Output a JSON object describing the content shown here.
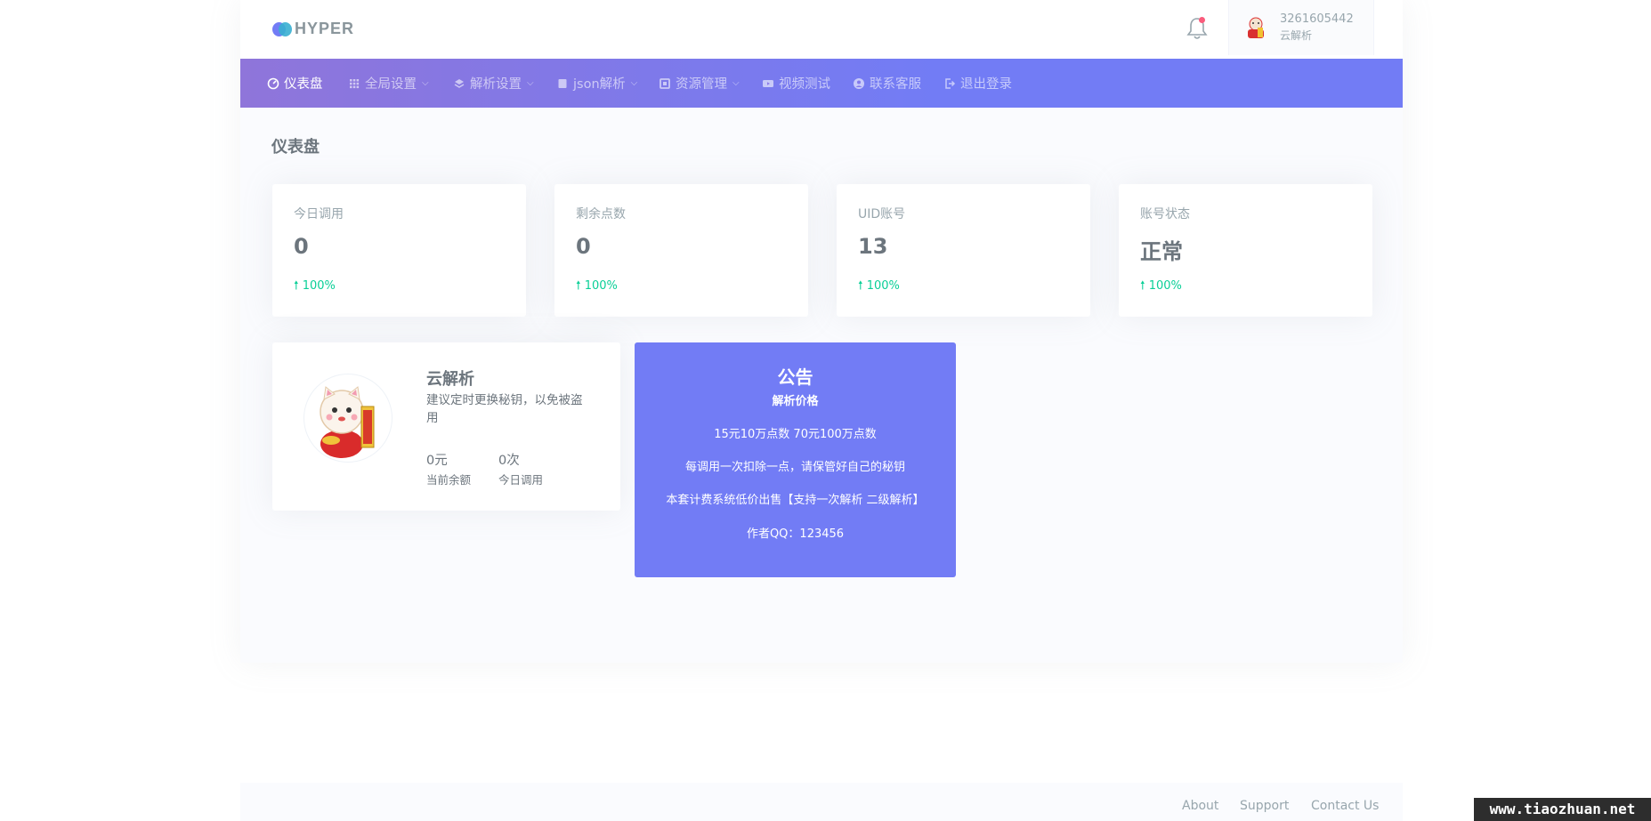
{
  "brand": {
    "logo_text": "HYPER"
  },
  "header": {
    "notification_icon": "bell-icon",
    "user": {
      "name": "3261605442",
      "role": "云解析"
    }
  },
  "nav": {
    "items": [
      {
        "label": "仪表盘",
        "icon": "dashboard-icon",
        "active": true
      },
      {
        "label": "全局设置",
        "icon": "grid-icon",
        "dropdown": true
      },
      {
        "label": "解析设置",
        "icon": "layers-icon",
        "dropdown": true
      },
      {
        "label": "json解析",
        "icon": "book-icon",
        "dropdown": true
      },
      {
        "label": "资源管理",
        "icon": "box-icon",
        "dropdown": true
      },
      {
        "label": "视频测试",
        "icon": "video-icon"
      },
      {
        "label": "联系客服",
        "icon": "user-circle-icon"
      },
      {
        "label": "退出登录",
        "icon": "logout-icon"
      }
    ]
  },
  "page": {
    "title": "仪表盘"
  },
  "stats": [
    {
      "label": "今日调用",
      "value": "0",
      "change": "100%"
    },
    {
      "label": "剩余点数",
      "value": "0",
      "change": "100%"
    },
    {
      "label": "UID账号",
      "value": "13",
      "change": "100%"
    },
    {
      "label": "账号状态",
      "value": "正常",
      "change": "100%"
    }
  ],
  "profile": {
    "name": "云解析",
    "description": "建议定时更换秘钥，以免被盗用",
    "stat1_value": "0元",
    "stat1_label": "当前余额",
    "stat2_value": "0次",
    "stat2_label": "今日调用"
  },
  "notice": {
    "title": "公告",
    "subtitle": "解析价格",
    "lines": [
      "15元10万点数 70元100万点数",
      "每调用一次扣除一点，请保管好自己的秘钥",
      "本套计费系统低价出售【支持一次解析 二级解析】",
      "作者QQ：123456"
    ]
  },
  "footer": {
    "links": [
      "About",
      "Support",
      "Contact Us"
    ]
  },
  "watermark": "www.tiaozhuan.net",
  "colors": {
    "primary": "#727cf5",
    "nav_start": "#8f75da",
    "success": "#0acf97",
    "danger": "#fa5c7c"
  }
}
